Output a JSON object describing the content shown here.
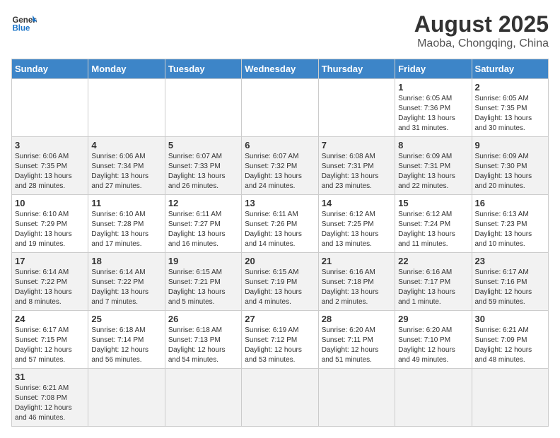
{
  "header": {
    "logo_general": "General",
    "logo_blue": "Blue",
    "title": "August 2025",
    "subtitle": "Maoba, Chongqing, China"
  },
  "weekdays": [
    "Sunday",
    "Monday",
    "Tuesday",
    "Wednesday",
    "Thursday",
    "Friday",
    "Saturday"
  ],
  "weeks": [
    [
      {
        "day": "",
        "info": ""
      },
      {
        "day": "",
        "info": ""
      },
      {
        "day": "",
        "info": ""
      },
      {
        "day": "",
        "info": ""
      },
      {
        "day": "",
        "info": ""
      },
      {
        "day": "1",
        "info": "Sunrise: 6:05 AM\nSunset: 7:36 PM\nDaylight: 13 hours and 31 minutes."
      },
      {
        "day": "2",
        "info": "Sunrise: 6:05 AM\nSunset: 7:35 PM\nDaylight: 13 hours and 30 minutes."
      }
    ],
    [
      {
        "day": "3",
        "info": "Sunrise: 6:06 AM\nSunset: 7:35 PM\nDaylight: 13 hours and 28 minutes."
      },
      {
        "day": "4",
        "info": "Sunrise: 6:06 AM\nSunset: 7:34 PM\nDaylight: 13 hours and 27 minutes."
      },
      {
        "day": "5",
        "info": "Sunrise: 6:07 AM\nSunset: 7:33 PM\nDaylight: 13 hours and 26 minutes."
      },
      {
        "day": "6",
        "info": "Sunrise: 6:07 AM\nSunset: 7:32 PM\nDaylight: 13 hours and 24 minutes."
      },
      {
        "day": "7",
        "info": "Sunrise: 6:08 AM\nSunset: 7:31 PM\nDaylight: 13 hours and 23 minutes."
      },
      {
        "day": "8",
        "info": "Sunrise: 6:09 AM\nSunset: 7:31 PM\nDaylight: 13 hours and 22 minutes."
      },
      {
        "day": "9",
        "info": "Sunrise: 6:09 AM\nSunset: 7:30 PM\nDaylight: 13 hours and 20 minutes."
      }
    ],
    [
      {
        "day": "10",
        "info": "Sunrise: 6:10 AM\nSunset: 7:29 PM\nDaylight: 13 hours and 19 minutes."
      },
      {
        "day": "11",
        "info": "Sunrise: 6:10 AM\nSunset: 7:28 PM\nDaylight: 13 hours and 17 minutes."
      },
      {
        "day": "12",
        "info": "Sunrise: 6:11 AM\nSunset: 7:27 PM\nDaylight: 13 hours and 16 minutes."
      },
      {
        "day": "13",
        "info": "Sunrise: 6:11 AM\nSunset: 7:26 PM\nDaylight: 13 hours and 14 minutes."
      },
      {
        "day": "14",
        "info": "Sunrise: 6:12 AM\nSunset: 7:25 PM\nDaylight: 13 hours and 13 minutes."
      },
      {
        "day": "15",
        "info": "Sunrise: 6:12 AM\nSunset: 7:24 PM\nDaylight: 13 hours and 11 minutes."
      },
      {
        "day": "16",
        "info": "Sunrise: 6:13 AM\nSunset: 7:23 PM\nDaylight: 13 hours and 10 minutes."
      }
    ],
    [
      {
        "day": "17",
        "info": "Sunrise: 6:14 AM\nSunset: 7:22 PM\nDaylight: 13 hours and 8 minutes."
      },
      {
        "day": "18",
        "info": "Sunrise: 6:14 AM\nSunset: 7:22 PM\nDaylight: 13 hours and 7 minutes."
      },
      {
        "day": "19",
        "info": "Sunrise: 6:15 AM\nSunset: 7:21 PM\nDaylight: 13 hours and 5 minutes."
      },
      {
        "day": "20",
        "info": "Sunrise: 6:15 AM\nSunset: 7:19 PM\nDaylight: 13 hours and 4 minutes."
      },
      {
        "day": "21",
        "info": "Sunrise: 6:16 AM\nSunset: 7:18 PM\nDaylight: 13 hours and 2 minutes."
      },
      {
        "day": "22",
        "info": "Sunrise: 6:16 AM\nSunset: 7:17 PM\nDaylight: 13 hours and 1 minute."
      },
      {
        "day": "23",
        "info": "Sunrise: 6:17 AM\nSunset: 7:16 PM\nDaylight: 12 hours and 59 minutes."
      }
    ],
    [
      {
        "day": "24",
        "info": "Sunrise: 6:17 AM\nSunset: 7:15 PM\nDaylight: 12 hours and 57 minutes."
      },
      {
        "day": "25",
        "info": "Sunrise: 6:18 AM\nSunset: 7:14 PM\nDaylight: 12 hours and 56 minutes."
      },
      {
        "day": "26",
        "info": "Sunrise: 6:18 AM\nSunset: 7:13 PM\nDaylight: 12 hours and 54 minutes."
      },
      {
        "day": "27",
        "info": "Sunrise: 6:19 AM\nSunset: 7:12 PM\nDaylight: 12 hours and 53 minutes."
      },
      {
        "day": "28",
        "info": "Sunrise: 6:20 AM\nSunset: 7:11 PM\nDaylight: 12 hours and 51 minutes."
      },
      {
        "day": "29",
        "info": "Sunrise: 6:20 AM\nSunset: 7:10 PM\nDaylight: 12 hours and 49 minutes."
      },
      {
        "day": "30",
        "info": "Sunrise: 6:21 AM\nSunset: 7:09 PM\nDaylight: 12 hours and 48 minutes."
      }
    ],
    [
      {
        "day": "31",
        "info": "Sunrise: 6:21 AM\nSunset: 7:08 PM\nDaylight: 12 hours and 46 minutes."
      },
      {
        "day": "",
        "info": ""
      },
      {
        "day": "",
        "info": ""
      },
      {
        "day": "",
        "info": ""
      },
      {
        "day": "",
        "info": ""
      },
      {
        "day": "",
        "info": ""
      },
      {
        "day": "",
        "info": ""
      }
    ]
  ]
}
